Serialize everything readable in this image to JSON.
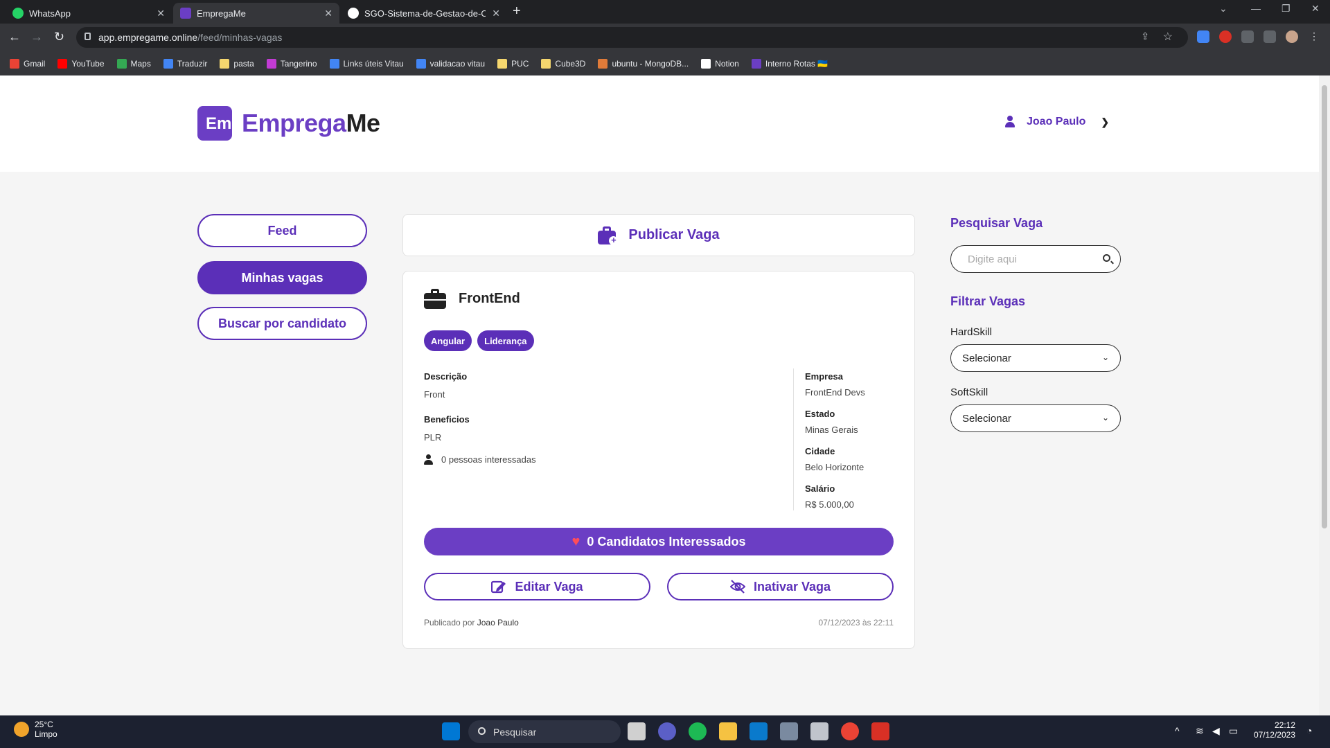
{
  "browser": {
    "tabs": [
      {
        "title": "WhatsApp",
        "color": "#25d366"
      },
      {
        "title": "EmpregaMe",
        "color": "#6b3ec4"
      },
      {
        "title": "SGO-Sistema-de-Gestao-de-ON",
        "color": "#ffffff"
      }
    ],
    "url_host": "app.empregame.online",
    "url_path": "/feed/minhas-vagas",
    "bookmarks": [
      {
        "label": "Gmail",
        "color": "#ea4335"
      },
      {
        "label": "YouTube",
        "color": "#ff0000"
      },
      {
        "label": "Maps",
        "color": "#34a853"
      },
      {
        "label": "Traduzir",
        "color": "#4285f4"
      },
      {
        "label": "pasta",
        "color": "#f5d76e"
      },
      {
        "label": "Tangerino",
        "color": "#c23bd4"
      },
      {
        "label": "Links úteis Vitau",
        "color": "#4285f4"
      },
      {
        "label": "validacao vitau",
        "color": "#4285f4"
      },
      {
        "label": "PUC",
        "color": "#f5d76e"
      },
      {
        "label": "Cube3D",
        "color": "#f5d76e"
      },
      {
        "label": "ubuntu - MongoDB...",
        "color": "#e07b39"
      },
      {
        "label": "Notion",
        "color": "#ffffff"
      },
      {
        "label": "Interno Rotas 🇺🇦",
        "color": "#6b3ec4"
      }
    ]
  },
  "header": {
    "logo_part1": "Emprega",
    "logo_part2": "Me",
    "user_name": "Joao Paulo"
  },
  "nav": {
    "feed": "Feed",
    "minhas_vagas": "Minhas vagas",
    "buscar": "Buscar por candidato"
  },
  "publish": {
    "label": "Publicar Vaga"
  },
  "job": {
    "title": "FrontEnd",
    "tags": [
      "Angular",
      "Liderança"
    ],
    "descricao_label": "Descrição",
    "descricao": "Front",
    "beneficios_label": "Beneficios",
    "beneficios": "PLR",
    "interessados": "0 pessoas interessadas",
    "empresa_label": "Empresa",
    "empresa": "FrontEnd Devs",
    "estado_label": "Estado",
    "estado": "Minas Gerais",
    "cidade_label": "Cidade",
    "cidade": "Belo Horizonte",
    "salario_label": "Salário",
    "salario": "R$ 5.000,00",
    "candidatos_btn": "0 Candidatos Interessados",
    "editar_btn": "Editar Vaga",
    "inativar_btn": "Inativar Vaga",
    "publicado_por": "Publicado por",
    "autor": "Joao Paulo",
    "data": "07/12/2023 às 22:11"
  },
  "sidebar": {
    "pesquisar_title": "Pesquisar Vaga",
    "search_placeholder": "Digite aqui",
    "filtrar_title": "Filtrar Vagas",
    "hardskill_label": "HardSkill",
    "hardskill_value": "Selecionar",
    "softskill_label": "SoftSkill",
    "softskill_value": "Selecionar"
  },
  "taskbar": {
    "temp": "25°C",
    "weather": "Limpo",
    "search": "Pesquisar",
    "time": "22:12",
    "date": "07/12/2023"
  },
  "colors": {
    "brand": "#5b2fb8",
    "brand_light": "#6b3ec4",
    "heart": "#ff4d5a"
  }
}
